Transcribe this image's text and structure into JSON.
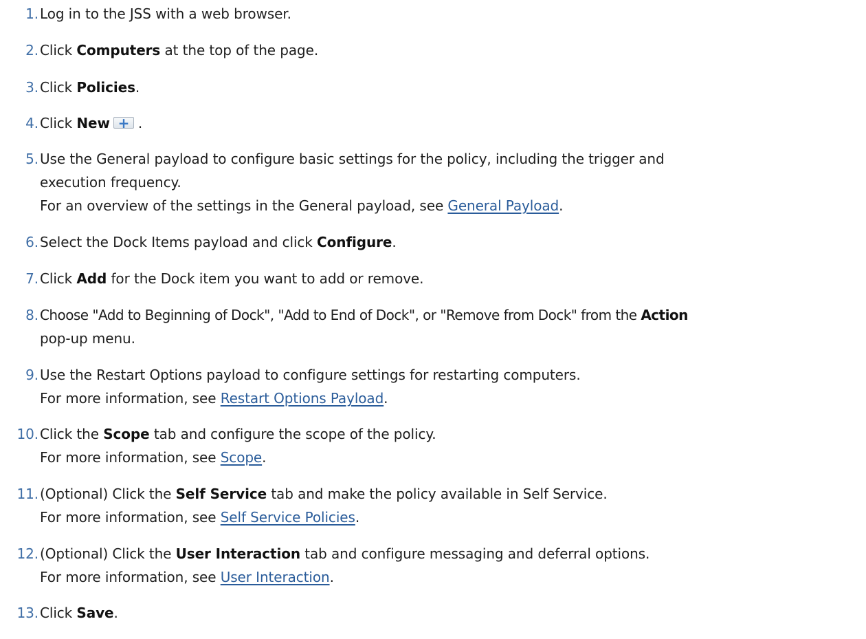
{
  "steps": [
    {
      "num": "1.",
      "text": "Log in to the JSS with a web browser."
    },
    {
      "num": "2.",
      "pre": "Click ",
      "bold": "Computers",
      "post": " at the top of the page."
    },
    {
      "num": "3.",
      "pre": "Click ",
      "bold": "Policies",
      "post": "."
    },
    {
      "num": "4.",
      "pre": "Click ",
      "bold": "New",
      "post": ".",
      "button_glyph": "+",
      "button_icon": "plus-icon"
    },
    {
      "num": "5.",
      "line1": "Use the General payload to configure basic settings for the policy, including the trigger and",
      "line2": "execution frequency.",
      "line3_pre": "For an overview of the settings in the General payload, see ",
      "link": "General Payload",
      "line3_post": "."
    },
    {
      "num": "6.",
      "pre": "Select the Dock Items payload and click ",
      "bold": "Configure",
      "post": "."
    },
    {
      "num": "7.",
      "pre": "Click ",
      "bold": "Add",
      "post": " for the Dock item you want to add or remove."
    },
    {
      "num": "8.",
      "pre": "Choose \"Add to Beginning of Dock\", \"Add to End of Dock\", or \"Remove from Dock\" from the ",
      "bold": "Action",
      "line2": "pop-up menu."
    },
    {
      "num": "9.",
      "line1": "Use the Restart Options payload to configure settings for restarting computers.",
      "line2_pre": "For more information, see ",
      "link": "Restart Options Payload",
      "line2_post": "."
    },
    {
      "num": "10.",
      "pre": "Click the ",
      "bold": "Scope",
      "post": " tab and configure the scope of the policy.",
      "line2_pre": "For more information, see ",
      "link": "Scope",
      "line2_post": "."
    },
    {
      "num": "11.",
      "pre": "(Optional) Click the ",
      "bold": "Self Service",
      "post": " tab and make the policy available in Self Service.",
      "line2_pre": "For more information, see ",
      "link": "Self Service Policies",
      "line2_post": "."
    },
    {
      "num": "12.",
      "pre": "(Optional) Click the ",
      "bold": "User Interaction",
      "post": " tab and configure messaging and deferral options.",
      "line2_pre": "For more information, see ",
      "link": "User Interaction",
      "line2_post": "."
    },
    {
      "num": "13.",
      "pre": "Click ",
      "bold": "Save",
      "post": "."
    }
  ],
  "colors": {
    "step_number": "#3f6ea6",
    "link": "#2a5c9a",
    "text": "#1e1e1e"
  }
}
